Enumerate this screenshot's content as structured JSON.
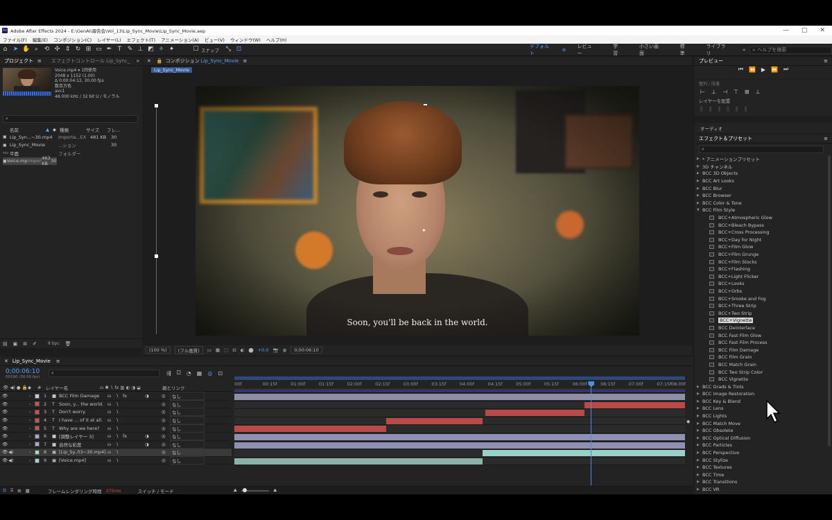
{
  "window": {
    "title": "Adobe After Effects 2024 - E:\\GenAI\\報告会\\Vol_13\\Lip_Sync_Movie\\Lip_Sync_Movie.aep",
    "controls": [
      "—",
      "▢",
      "✕"
    ]
  },
  "menu": [
    "ファイル(F)",
    "編集(E)",
    "コンポジション(C)",
    "レイヤー(L)",
    "エフェクト(T)",
    "アニメーション(A)",
    "ビュー(V)",
    "ウィンドウ(W)",
    "ヘルプ(H)"
  ],
  "toolbar": {
    "snap_label": "スナップ",
    "workspaces": [
      "デフォルト",
      "レビュー",
      "学習",
      "小さい画面",
      "標準",
      "ライブラリ"
    ],
    "active_workspace": "デフォルト",
    "help_placeholder": "ヘルプを検索"
  },
  "project": {
    "tab": "プロジェクト",
    "tab2": "エフェクトコントロール Lip_Sync_",
    "info": {
      "name": "Voice.mp4 ▾",
      "used": "1回使用",
      "dims": "2048 x 1152 (1.00)",
      "dur": "Δ 0;00:04:12, 30.00 fps",
      "color": "数百万色",
      "codec": "avc1",
      "audio": "48.000 kHz / 32 bit U / モノラル"
    },
    "headers": [
      "名前",
      "種類",
      "サイズ",
      "フレ..."
    ],
    "rows": [
      {
        "name": "Lip_Syn...~30.mp4",
        "type": "Importe...EX",
        "size": "481 KB",
        "fr": "30"
      },
      {
        "name": "Lip_Sync_Movie",
        "type": "...ション",
        "size": "",
        "fr": "30"
      },
      {
        "name": "平面",
        "type": "フォルダー",
        "size": "",
        "fr": ""
      },
      {
        "name": "Voice.mp4",
        "type": "Importe...EX",
        "size": "463 KB",
        "fr": "30"
      }
    ],
    "bpc": "8 bpc"
  },
  "comp": {
    "tab": "コンポジション",
    "tab_name": "Lip_Sync_Movie",
    "sub_tab": "Lip_Sync_Movie",
    "subtitle": "Soon, you'll be back in the world.",
    "zoom": "(100 %)",
    "res": "(フル画質)",
    "exposure": "+0.0",
    "timecode": "0;00:06:10"
  },
  "preview": {
    "tab": "プレビュー"
  },
  "align": {
    "title": "整列 / 段落",
    "label": "レイヤーを配置"
  },
  "audio": {
    "label": "オーディオ"
  },
  "effects": {
    "tab": "エフェクト＆プリセット",
    "items": [
      {
        "label": "* アニメーションプリセット",
        "indent": 0,
        "open": false
      },
      {
        "label": "3D チャンネル",
        "indent": 0,
        "open": false
      },
      {
        "label": "BCC 3D Objects",
        "indent": 0,
        "open": false
      },
      {
        "label": "BCC Art Looks",
        "indent": 0,
        "open": false
      },
      {
        "label": "BCC Blur",
        "indent": 0,
        "open": false
      },
      {
        "label": "BCC Browser",
        "indent": 0,
        "open": false
      },
      {
        "label": "BCC Color & Tone",
        "indent": 0,
        "open": false
      },
      {
        "label": "BCC Film Style",
        "indent": 0,
        "open": true
      },
      {
        "label": "BCC+Atmospheric Glow",
        "indent": 1
      },
      {
        "label": "BCC+Bleach Bypass",
        "indent": 1
      },
      {
        "label": "BCC+Cross Processing",
        "indent": 1
      },
      {
        "label": "BCC+Day for Night",
        "indent": 1
      },
      {
        "label": "BCC+Film Glow",
        "indent": 1
      },
      {
        "label": "BCC+Film Grunge",
        "indent": 1
      },
      {
        "label": "BCC+Film Stocks",
        "indent": 1
      },
      {
        "label": "BCC+Flashing",
        "indent": 1
      },
      {
        "label": "BCC+Light Flicker",
        "indent": 1
      },
      {
        "label": "BCC+Looks",
        "indent": 1
      },
      {
        "label": "BCC+Orbs",
        "indent": 1
      },
      {
        "label": "BCC+Smoke and Fog",
        "indent": 1
      },
      {
        "label": "BCC+Three Strip",
        "indent": 1
      },
      {
        "label": "BCC+Two Strip",
        "indent": 1
      },
      {
        "label": "BCC+Vignette",
        "indent": 1,
        "selected": true
      },
      {
        "label": "BCC Deinterlace",
        "indent": 1
      },
      {
        "label": "BCC Fast Film Glow",
        "indent": 1
      },
      {
        "label": "BCC Fast Film Process",
        "indent": 1
      },
      {
        "label": "BCC Film Damage",
        "indent": 1
      },
      {
        "label": "BCC Film Grain",
        "indent": 1
      },
      {
        "label": "BCC Match Grain",
        "indent": 1
      },
      {
        "label": "BCC Two Strip Color",
        "indent": 1
      },
      {
        "label": "BCC Vignette",
        "indent": 1
      },
      {
        "label": "BCC Grads & Tints",
        "indent": 0,
        "open": false
      },
      {
        "label": "BCC Image Restoration",
        "indent": 0,
        "open": false
      },
      {
        "label": "BCC Key & Blend",
        "indent": 0,
        "open": false
      },
      {
        "label": "BCC Lens",
        "indent": 0,
        "open": false
      },
      {
        "label": "BCC Lights",
        "indent": 0,
        "open": false
      },
      {
        "label": "BCC Match Move",
        "indent": 0,
        "open": false
      },
      {
        "label": "BCC Obsolete",
        "indent": 0,
        "open": false
      },
      {
        "label": "BCC Optical Diffusion",
        "indent": 0,
        "open": false
      },
      {
        "label": "BCC Particles",
        "indent": 0,
        "open": false
      },
      {
        "label": "BCC Perspective",
        "indent": 0,
        "open": false
      },
      {
        "label": "BCC Stylize",
        "indent": 0,
        "open": false
      },
      {
        "label": "BCC Textures",
        "indent": 0,
        "open": false
      },
      {
        "label": "BCC Time",
        "indent": 0,
        "open": false
      },
      {
        "label": "BCC Transitions",
        "indent": 0,
        "open": false
      },
      {
        "label": "BCC VR",
        "indent": 0,
        "open": false
      }
    ]
  },
  "timeline": {
    "tab": "Lip_Sync_Movie",
    "timecode": "0;00:06:10",
    "frame_info": "00190 (30.00 fps)",
    "col_layer": "レイヤー名",
    "col_parent": "親とリンク",
    "ruler": [
      "00f",
      "00:15f",
      "01:00f",
      "01:15f",
      "02:00f",
      "02:15f",
      "03:00f",
      "03:15f",
      "04:00f",
      "04:15f",
      "05:00f",
      "05:15f",
      "06:00f",
      "06:15f",
      "07:00f",
      "07:15f",
      "08:00f"
    ],
    "ruler_end_seconds": 8,
    "playhead_seconds": 6.33,
    "layers": [
      {
        "num": "1",
        "type": "solid",
        "name": "BCC Film Damage",
        "color": "#c9c9e6",
        "parent": "なし",
        "fx": true,
        "start": 0,
        "end": 8,
        "bar": "#8e8ea6"
      },
      {
        "num": "2",
        "type": "T",
        "name": "Soon, y... the world.",
        "color": "#d05050",
        "parent": "なし",
        "start": 6.22,
        "end": 8,
        "bar": "#b84a4a"
      },
      {
        "num": "3",
        "type": "T",
        "name": "Don't worry.",
        "color": "#d05050",
        "parent": "なし",
        "start": 4.45,
        "end": 6.22,
        "bar": "#b84a4a"
      },
      {
        "num": "4",
        "type": "T",
        "name": "I have ... of it at all.",
        "color": "#d05050",
        "parent": "なし",
        "start": 2.7,
        "end": 4.4,
        "bar": "#b84a4a"
      },
      {
        "num": "5",
        "type": "T",
        "name": "Why are we here?",
        "color": "#d05050",
        "parent": "なし",
        "start": 0,
        "end": 2.7,
        "bar": "#b84a4a"
      },
      {
        "num": "6",
        "type": "solid",
        "name": "[調整レイヤー 3]",
        "color": "#a8a8d4",
        "parent": "なし",
        "fx": true,
        "start": 0,
        "end": 8,
        "bar": "#9090b2"
      },
      {
        "num": "7",
        "type": "solid",
        "name": "自然な彩度",
        "color": "#a8a8d4",
        "parent": "なし",
        "start": 0,
        "end": 8,
        "bar": "#9090b2"
      },
      {
        "num": "8",
        "type": "video",
        "name": "[Lip_Sy..03~30.mp4]",
        "color": "#a5d6cf",
        "parent": "なし",
        "start": 4.4,
        "end": 8,
        "bar": "#9ad0c8"
      },
      {
        "num": "9",
        "type": "video",
        "name": "[Voice.mp4]",
        "color": "#a5d6cf",
        "parent": "なし",
        "start": 0,
        "end": 4.4,
        "bar": "#8cb0aa"
      }
    ],
    "render_label": "フレームレンダリング時間",
    "render_time": "375ms",
    "switch_label": "スイッチ / モード"
  }
}
